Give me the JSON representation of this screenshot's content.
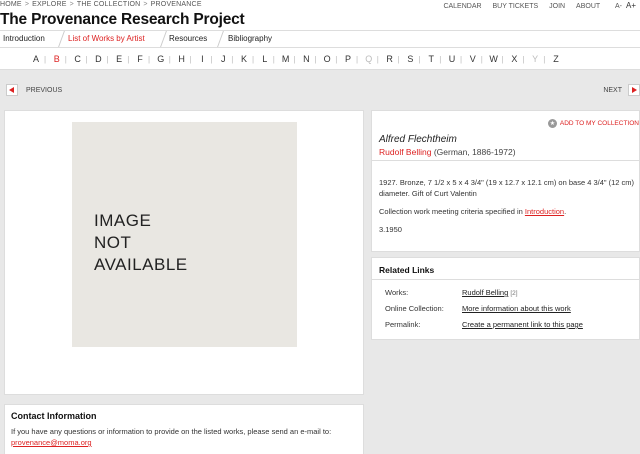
{
  "breadcrumb": [
    "HOME",
    "EXPLORE",
    "THE COLLECTION",
    "PROVENANCE"
  ],
  "breadcrumb_separator": ">",
  "utility_nav": {
    "calendar": "CALENDAR",
    "tickets": "BUY TICKETS",
    "join": "JOIN",
    "about": "ABOUT",
    "font_smaller": "A-",
    "font_larger": "A+"
  },
  "site_title": "The Provenance Research Project",
  "tabs": [
    {
      "label": "Introduction",
      "active": false
    },
    {
      "label": "List of Works by Artist",
      "active": true
    },
    {
      "label": "Resources",
      "active": false
    },
    {
      "label": "Bibliography",
      "active": false
    }
  ],
  "alphabet": [
    {
      "l": "A",
      "state": "normal"
    },
    {
      "l": "B",
      "state": "active"
    },
    {
      "l": "C",
      "state": "normal"
    },
    {
      "l": "D",
      "state": "normal"
    },
    {
      "l": "E",
      "state": "normal"
    },
    {
      "l": "F",
      "state": "normal"
    },
    {
      "l": "G",
      "state": "normal"
    },
    {
      "l": "H",
      "state": "normal"
    },
    {
      "l": "I",
      "state": "normal"
    },
    {
      "l": "J",
      "state": "normal"
    },
    {
      "l": "K",
      "state": "normal"
    },
    {
      "l": "L",
      "state": "normal"
    },
    {
      "l": "M",
      "state": "normal"
    },
    {
      "l": "N",
      "state": "normal"
    },
    {
      "l": "O",
      "state": "normal"
    },
    {
      "l": "P",
      "state": "normal"
    },
    {
      "l": "Q",
      "state": "disabled"
    },
    {
      "l": "R",
      "state": "normal"
    },
    {
      "l": "S",
      "state": "normal"
    },
    {
      "l": "T",
      "state": "normal"
    },
    {
      "l": "U",
      "state": "normal"
    },
    {
      "l": "V",
      "state": "normal"
    },
    {
      "l": "W",
      "state": "normal"
    },
    {
      "l": "X",
      "state": "normal"
    },
    {
      "l": "Y",
      "state": "disabled"
    },
    {
      "l": "Z",
      "state": "normal"
    }
  ],
  "pager": {
    "previous": "PREVIOUS",
    "next": "NEXT"
  },
  "image_placeholder": "IMAGE\nNOT\nAVAILABLE",
  "contact": {
    "heading": "Contact Information",
    "text": "If you have any questions or information to provide on the listed works, please send an e-mail to: ",
    "email": "provenance@moma.org"
  },
  "work": {
    "add_to_collection": "ADD TO MY COLLECTION",
    "title": "Alfred Flechtheim",
    "artist": "Rudolf Belling",
    "artist_info": " (German, 1886-1972)",
    "details": "1927. Bronze, 7 1/2 x 5 x 4 3/4\" (19 x 12.7 x 12.1 cm) on base 4 3/4\" (12 cm) diameter. Gift of Curt Valentin",
    "criteria_text": "Collection work meeting criteria specified in ",
    "criteria_link": "Introduction",
    "criteria_end": ".",
    "accession": "3.1950"
  },
  "related": {
    "heading": "Related Links",
    "rows": [
      {
        "label": "Works:",
        "value": "Rudolf Belling",
        "count": "[2]"
      },
      {
        "label": "Online Collection:",
        "value": "More information about this work",
        "count": ""
      },
      {
        "label": "Permalink:",
        "value": "Create a permanent link to this page",
        "count": ""
      }
    ]
  },
  "colors": {
    "accent": "#dd2222",
    "background": "#e8e8e8"
  },
  "icons": {
    "prev": "left-arrow-icon",
    "next": "right-arrow-icon",
    "add": "star-icon"
  }
}
